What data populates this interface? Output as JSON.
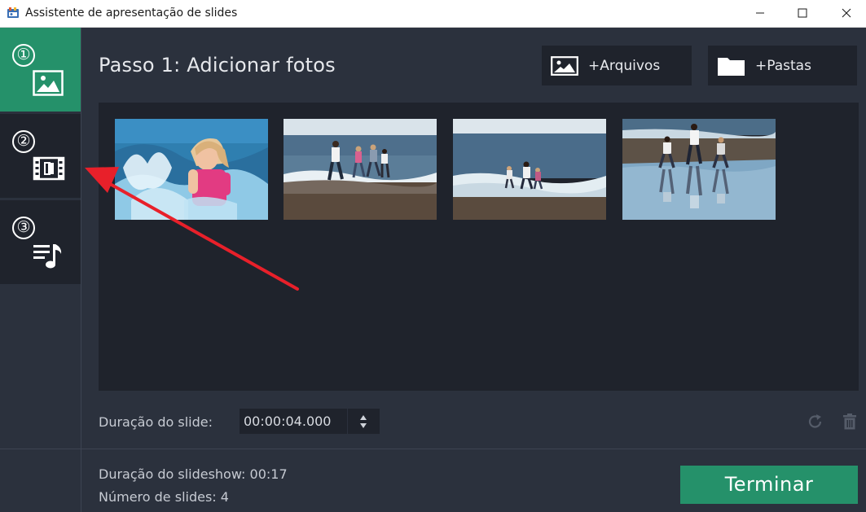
{
  "window": {
    "title": "Assistente de apresentação de slides",
    "app_icon": "movavi-slideshow-icon",
    "controls": [
      "minimize-icon",
      "maximize-icon",
      "close-icon"
    ]
  },
  "steps": [
    {
      "number": "①",
      "icon": "image-icon",
      "active": true
    },
    {
      "number": "②",
      "icon": "film-transition-icon",
      "active": false
    },
    {
      "number": "③",
      "icon": "music-playlist-icon",
      "active": false
    }
  ],
  "main": {
    "title": "Passo 1: Adicionar fotos",
    "add_files_label": "+Arquivos",
    "add_folders_label": "+Pastas",
    "photos": [
      {
        "name": "girl-splashing-in-sea"
      },
      {
        "name": "family-running-on-beach"
      },
      {
        "name": "kids-playing-in-waves"
      },
      {
        "name": "family-reflection-on-wet-sand"
      }
    ]
  },
  "duration": {
    "label": "Duração do slide:",
    "value": "00:00:04.000"
  },
  "summary": {
    "slideshow_duration": "Duração do slideshow: 00:17",
    "slide_count": "Número de slides: 4"
  },
  "finish_label": "Terminar",
  "colors": {
    "accent_green": "#25916a",
    "background": "#2b313d",
    "panel": "#1f232c",
    "annotation_red": "#e8202a"
  }
}
